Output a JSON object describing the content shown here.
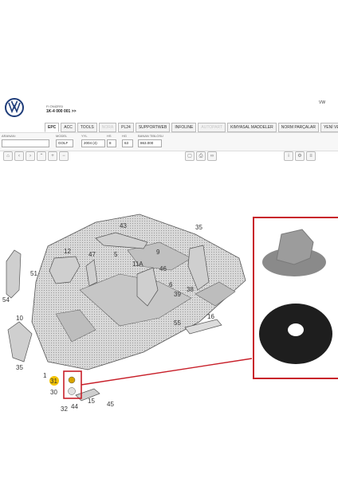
{
  "header": {
    "small_label": "FI ÖNİZRSI",
    "catalog_no": "1K-4 000 001 >>",
    "brand_short": "VW"
  },
  "tabs": [
    {
      "label": "EPC",
      "state": "active"
    },
    {
      "label": "ACC",
      "state": "normal"
    },
    {
      "label": "TOOLS",
      "state": "normal"
    },
    {
      "label": "NORA",
      "state": "dim"
    },
    {
      "label": "PL24",
      "state": "normal"
    },
    {
      "label": "SUPPORTWEB",
      "state": "normal"
    },
    {
      "label": "INFOLINE",
      "state": "normal"
    },
    {
      "label": "AUTOPART",
      "state": "dim"
    },
    {
      "label": "KIMYASAL MADDELER",
      "state": "normal"
    },
    {
      "label": "NORM PARÇALAR",
      "state": "normal"
    },
    {
      "label": "YENİ VE İPT",
      "state": "normal"
    }
  ],
  "filters": {
    "search_label": "ARANAN:",
    "model_label": "MODEL",
    "model_value": "GOLF",
    "year_label": "YYL",
    "year_value": "2004 (4)",
    "s_label": "HS",
    "s_value": "8",
    "g_label": "HG",
    "g_value": "63",
    "main_label": "BANAN TIBLOSU",
    "main_value": "863.000"
  },
  "callouts": [
    "43",
    "35",
    "47",
    "12",
    "5",
    "9",
    "11A",
    "46",
    "54",
    "51",
    "6",
    "38",
    "39",
    "10",
    "55",
    "16",
    "35",
    "1",
    "31",
    "30",
    "32",
    "44",
    "15",
    "45"
  ],
  "colors": {
    "highlight": "#c8202a",
    "callout_badge": "#f2c200",
    "part": "#cccccc"
  }
}
